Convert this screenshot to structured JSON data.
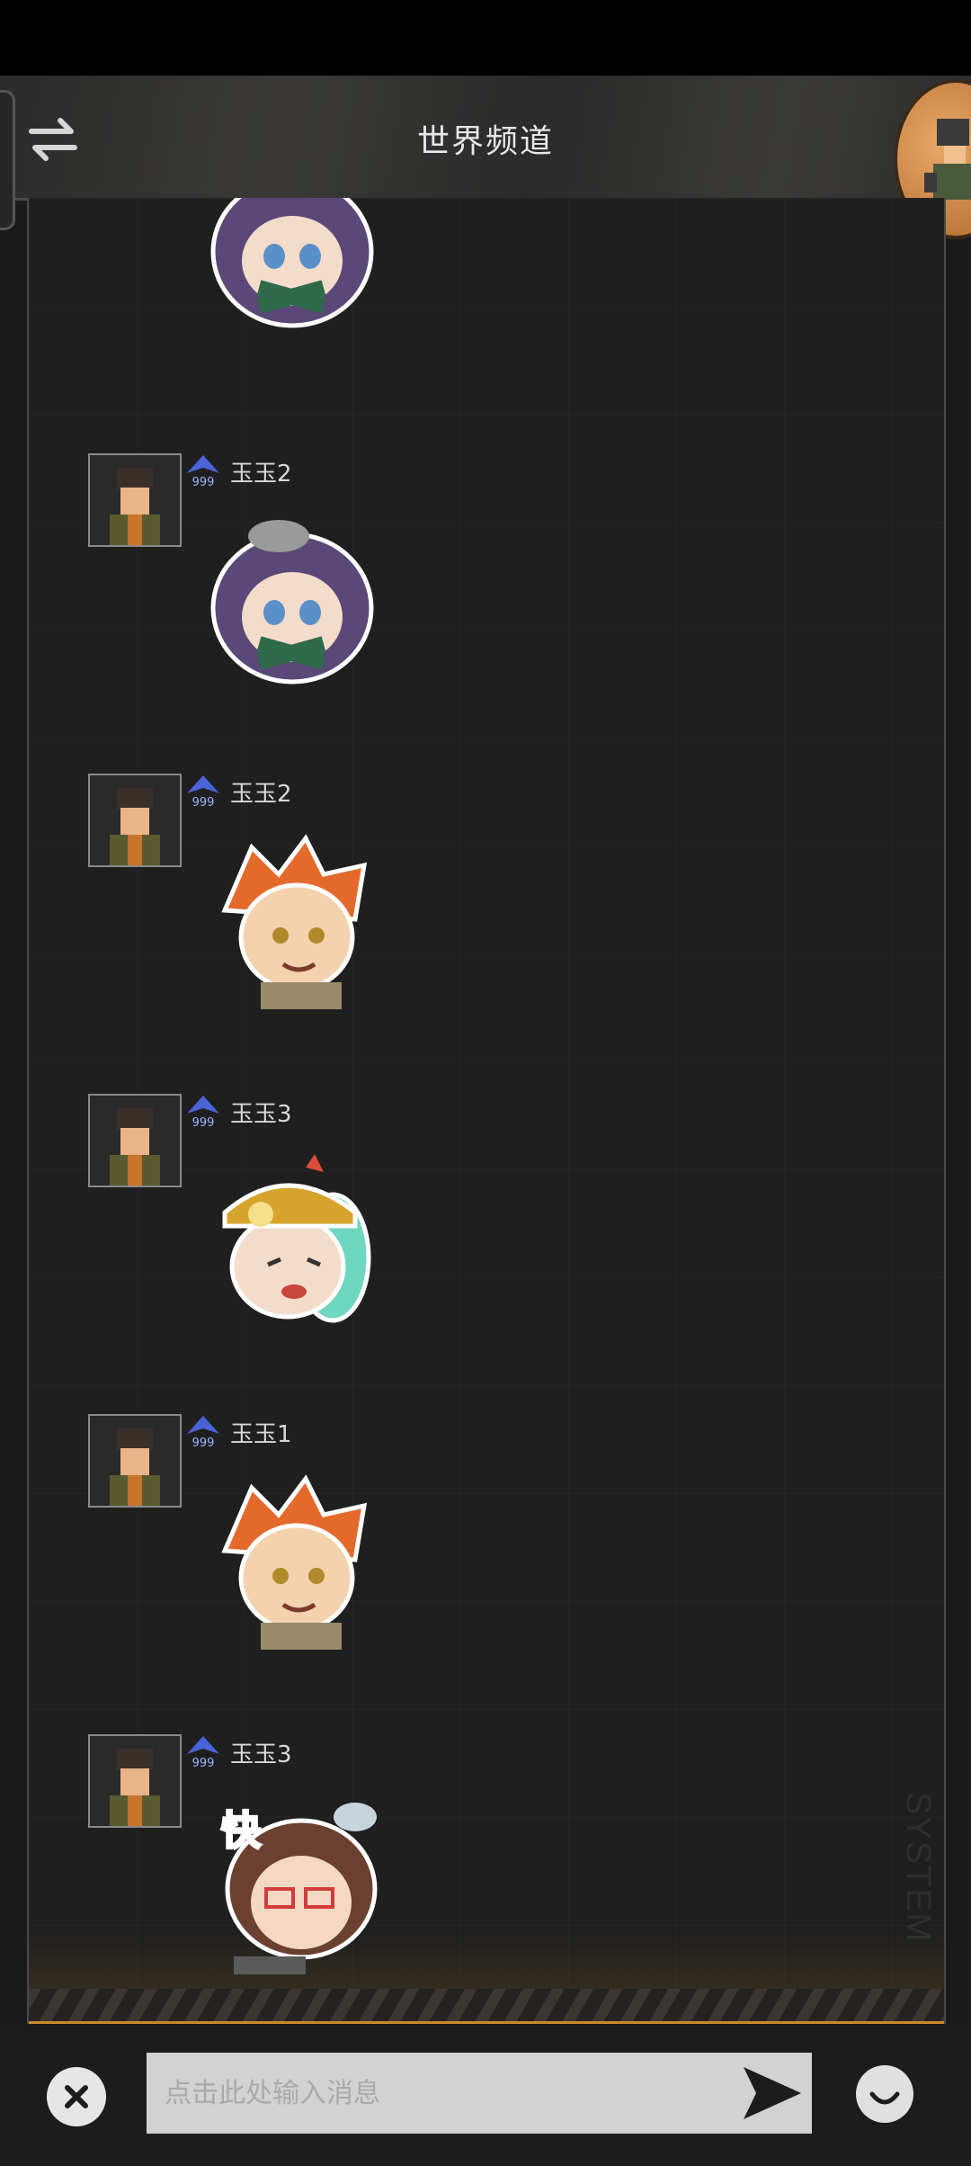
{
  "header": {
    "title": "世界频道",
    "switch_icon": "swap-arrows-icon",
    "corner_icon": "character-portrait"
  },
  "messages": [
    {
      "username": "玉玉2",
      "level_badge": "999",
      "sticker": "crying-purple-hair-girl-sticker"
    },
    {
      "username": "玉玉2",
      "level_badge": "999",
      "sticker": "orange-hair-boy-thumbs-sticker"
    },
    {
      "username": "玉玉3",
      "level_badge": "999",
      "sticker": "teal-hair-miner-girl-crying-sticker"
    },
    {
      "username": "玉玉1",
      "level_badge": "999",
      "sticker": "orange-hair-boy-thumbs-sticker"
    },
    {
      "username": "玉玉3",
      "level_badge": "999",
      "sticker": "glasses-girl-快-sticker",
      "sticker_text": "快"
    }
  ],
  "watermark": "SYSTEM",
  "input": {
    "placeholder": "点击此处输入消息",
    "value": ""
  },
  "colors": {
    "background": "#1f1f1f",
    "accent_line": "#c98a2c",
    "badge": "#4a63d8"
  }
}
